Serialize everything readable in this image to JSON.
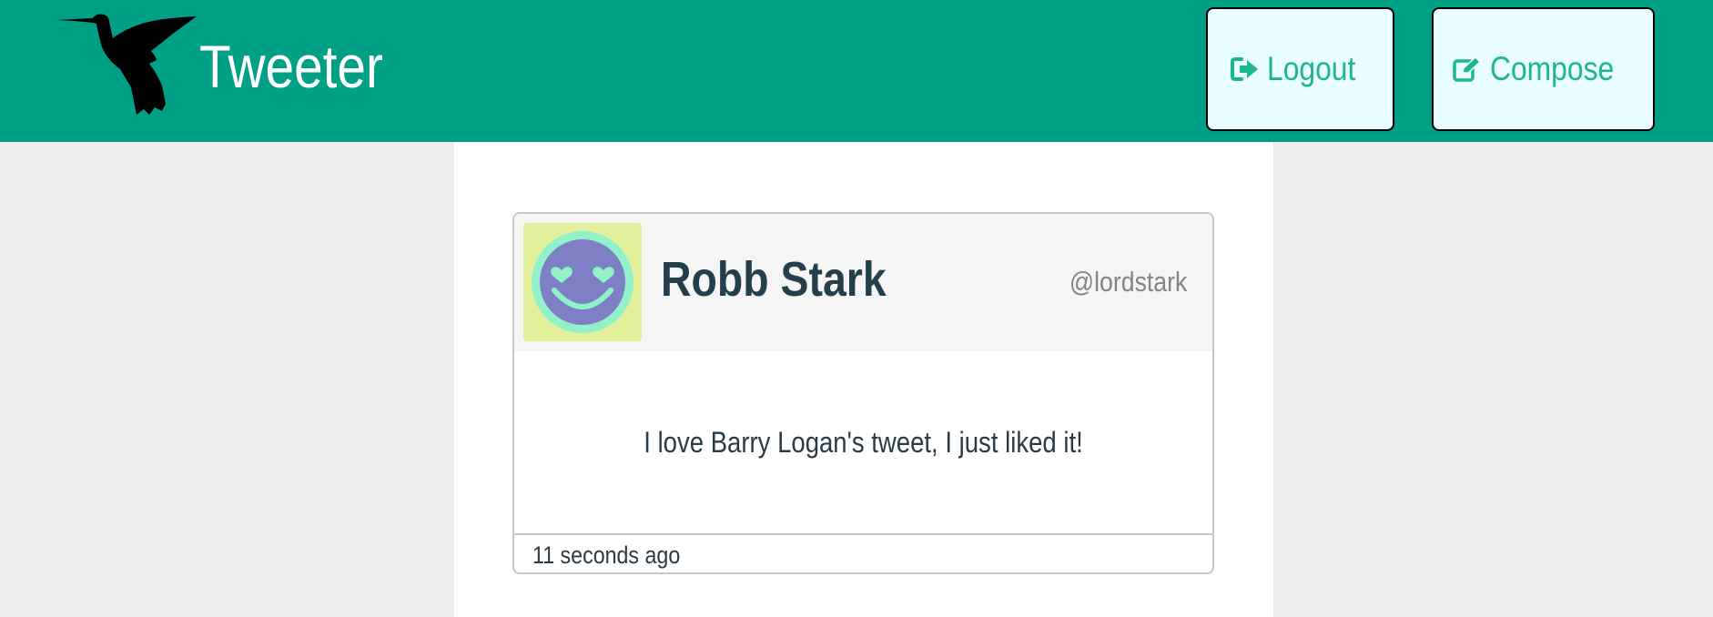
{
  "header": {
    "app_title": "Tweeter",
    "logo_icon": "hummingbird-icon",
    "logout_label": "Logout",
    "logout_icon": "sign-out-icon",
    "compose_label": "Compose",
    "compose_icon": "edit-icon"
  },
  "tweet": {
    "user_name": "Robb Stark",
    "handle": "@lordstark",
    "avatar_icon": "heart-eyes-smiley-icon",
    "content": "I love Barry Logan's tweet, I just liked it!",
    "timestamp": "11 seconds ago"
  },
  "colors": {
    "header_bg": "#00a087",
    "button_bg": "#e8fdff",
    "button_text": "#1fb58d",
    "name_text": "#233f4c",
    "page_bg": "#eeeeee",
    "avatar_bg": "#e2f09c",
    "avatar_face": "#7f7fc6",
    "avatar_ring": "#92f1c8"
  }
}
